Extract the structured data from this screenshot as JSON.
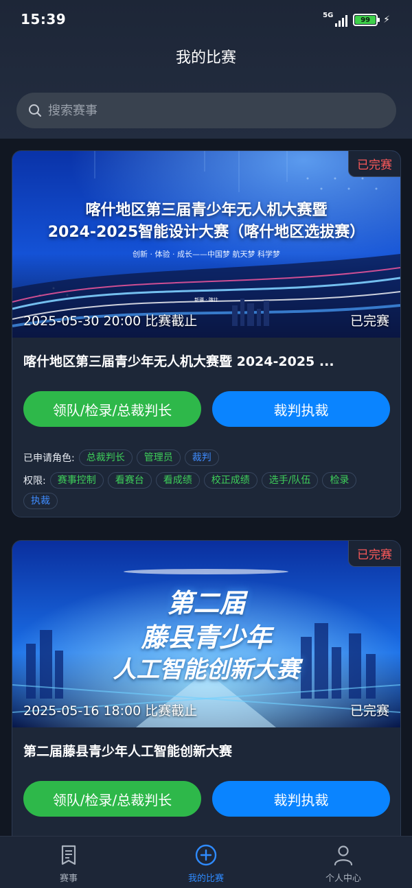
{
  "status_bar": {
    "time": "15:39",
    "network": "5G",
    "battery": "99"
  },
  "header": {
    "title": "我的比赛"
  },
  "search": {
    "placeholder": "搜索赛事"
  },
  "cards": [
    {
      "badge": "已完赛",
      "banner_title_line1": "喀什地区第三届青少年无人机大赛暨",
      "banner_title_line2": "2024-2025智能设计大赛（喀什地区选拔赛）",
      "banner_slogan": "创新 · 体验 · 成长——中国梦 航天梦 科学梦",
      "banner_small": "新疆 · 喀什",
      "deadline": "2025-05-30 20:00 比赛截止",
      "status": "已完赛",
      "name": "喀什地区第三届青少年无人机大赛暨 2024-2025 ...",
      "primary_button": "领队/检录/总裁判长",
      "secondary_button": "裁判执裁",
      "roles_label": "已申请角色:",
      "roles": [
        "总裁判长",
        "管理员",
        "裁判"
      ],
      "permissions_label": "权限:",
      "permissions": [
        "赛事控制",
        "看赛台",
        "看成绩",
        "校正成绩",
        "选手/队伍",
        "检录",
        "执裁"
      ]
    },
    {
      "badge": "已完赛",
      "banner_line1": "第二届",
      "banner_line2": "藤县青少年",
      "banner_line3": "人工智能创新大赛",
      "deadline": "2025-05-16 18:00 比赛截止",
      "status": "已完赛",
      "name": "第二届藤县青少年人工智能创新大赛",
      "primary_button": "领队/检录/总裁判长",
      "secondary_button": "裁判执裁"
    }
  ],
  "bottom_nav": [
    {
      "label": "赛事",
      "icon": "document-icon"
    },
    {
      "label": "我的比赛",
      "icon": "plus-circle-icon",
      "active": true
    },
    {
      "label": "个人中心",
      "icon": "person-icon"
    }
  ],
  "colors": {
    "accent_blue": "#0a84ff",
    "accent_green": "#2eb84a",
    "badge_red": "#ff5a5a",
    "background": "#111722"
  }
}
